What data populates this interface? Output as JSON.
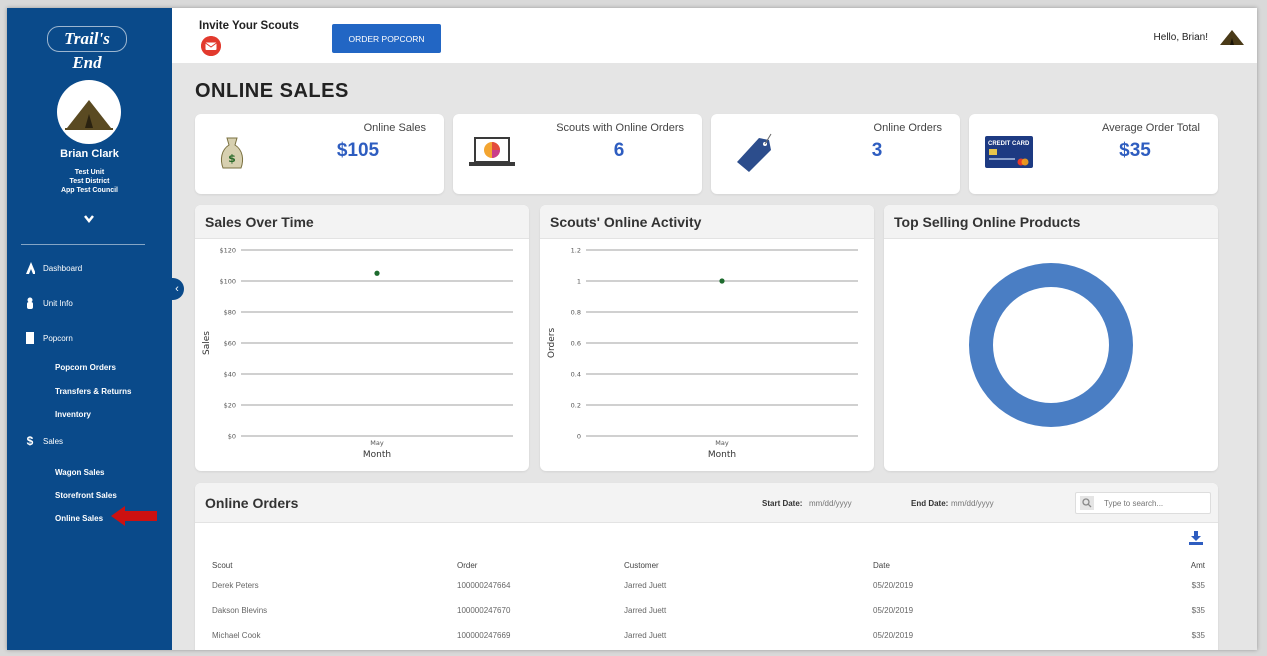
{
  "sidebar": {
    "logo_text": "Trail's End",
    "user_name": "Brian Clark",
    "unit": "Test Unit",
    "district": "Test District",
    "council": "App Test Council",
    "nav": [
      {
        "label": "Dashboard",
        "icon": "scout-emblem-icon"
      },
      {
        "label": "Unit Info",
        "icon": "person-icon"
      },
      {
        "label": "Popcorn",
        "icon": "popcorn-bag-icon"
      },
      {
        "label": "Sales",
        "icon": "dollar-icon"
      }
    ],
    "popcorn_sub": [
      "Popcorn Orders",
      "Transfers & Returns",
      "Inventory"
    ],
    "sales_sub": [
      "Wagon Sales",
      "Storefront Sales",
      "Online Sales"
    ],
    "dollar_glyph": "$"
  },
  "topbar": {
    "invite_label": "Invite Your Scouts",
    "order_button": "ORDER POPCORN",
    "greeting": "Hello, Brian!"
  },
  "page": {
    "title": "ONLINE SALES"
  },
  "stats": [
    {
      "label": "Online Sales",
      "value": "$105",
      "icon": "money-bag-icon"
    },
    {
      "label": "Scouts with Online Orders",
      "value": "6",
      "icon": "laptop-pie-icon"
    },
    {
      "label": "Online Orders",
      "value": "3",
      "icon": "price-tag-icon"
    },
    {
      "label": "Average Order Total",
      "value": "$35",
      "icon": "credit-card-icon",
      "card_text": "CREDIT CARD"
    }
  ],
  "panels": {
    "sales_over_time": "Sales Over Time",
    "scouts_activity": "Scouts' Online Activity",
    "top_products": "Top Selling Online Products"
  },
  "chart_data": [
    {
      "type": "scatter",
      "title": "Sales Over Time",
      "xlabel": "Month",
      "ylabel": "Sales",
      "categories": [
        "May"
      ],
      "values": [
        105
      ],
      "yticks": [
        "$0",
        "$20",
        "$40",
        "$60",
        "$80",
        "$100",
        "$120"
      ],
      "ylim": [
        0,
        120
      ],
      "grid": true
    },
    {
      "type": "scatter",
      "title": "Scouts' Online Activity",
      "xlabel": "Month",
      "ylabel": "Orders",
      "categories": [
        "May"
      ],
      "values": [
        1
      ],
      "yticks": [
        "0",
        "0.2",
        "0.4",
        "0.6",
        "0.8",
        "1",
        "1.2"
      ],
      "ylim": [
        0,
        1.2
      ],
      "grid": true
    },
    {
      "type": "pie",
      "title": "Top Selling Online Products",
      "values": [
        1
      ],
      "color": "#4a7ec4"
    }
  ],
  "orders": {
    "title": "Online Orders",
    "start_label": "Start Date:",
    "end_label": "End Date:",
    "date_placeholder": "mm/dd/yyyy",
    "search_placeholder": "Type to search...",
    "columns": [
      "Scout",
      "Order",
      "Customer",
      "Date",
      "Amt"
    ],
    "rows": [
      [
        "Derek Peters",
        "100000247664",
        "Jarred Juett",
        "05/20/2019",
        "$35"
      ],
      [
        "Dakson Blevins",
        "100000247670",
        "Jarred Juett",
        "05/20/2019",
        "$35"
      ],
      [
        "Michael Cook",
        "100000247669",
        "Jarred Juett",
        "05/20/2019",
        "$35"
      ]
    ]
  },
  "colors": {
    "sidebar": "#0a4a8a",
    "accent": "#2e5dc0",
    "button": "#2266c4",
    "donut": "#4a7ec4",
    "arrow": "#cc1111"
  }
}
